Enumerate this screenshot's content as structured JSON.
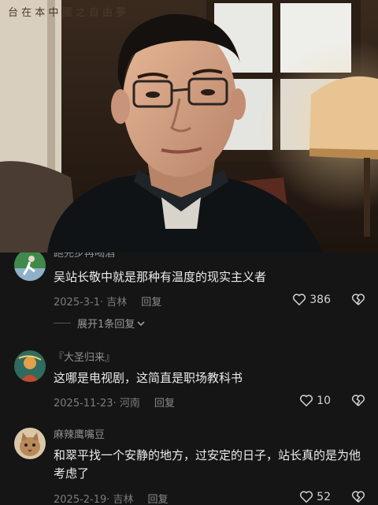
{
  "video": {
    "scroll_text": "台 在 本 中 國 之 自 由 夢"
  },
  "comments": [
    {
      "username": "跑完步再喝酒",
      "text": "吴站长敬中就是那种有温度的现实主义者",
      "date_location": "2025-3-1· 吉林",
      "reply_label": "回复",
      "likes": "386",
      "expand_label": "展开1条回复",
      "avatar_icon": "runner-avatar-icon",
      "avatar_color": "#3f8a4a"
    },
    {
      "username": "『大圣归来』",
      "text": "这哪是电视剧，这简直是职场教科书",
      "date_location": "2025-11-23· 河南",
      "reply_label": "回复",
      "likes": "10",
      "avatar_icon": "figure-avatar-icon",
      "avatar_color": "#2f6b5e"
    },
    {
      "username": "麻辣鹰嘴豆",
      "text": "和翠平找一个安静的地方，过安定的日子，站长真的是为他考虑了",
      "date_location": "2025-2-19· 吉林",
      "reply_label": "回复",
      "likes": "52",
      "avatar_icon": "cat-avatar-icon",
      "avatar_color": "#b88a5a"
    }
  ],
  "icons": {
    "like": "heart-icon",
    "dislike": "broken-heart-icon",
    "expand": "chevron-down-icon"
  }
}
